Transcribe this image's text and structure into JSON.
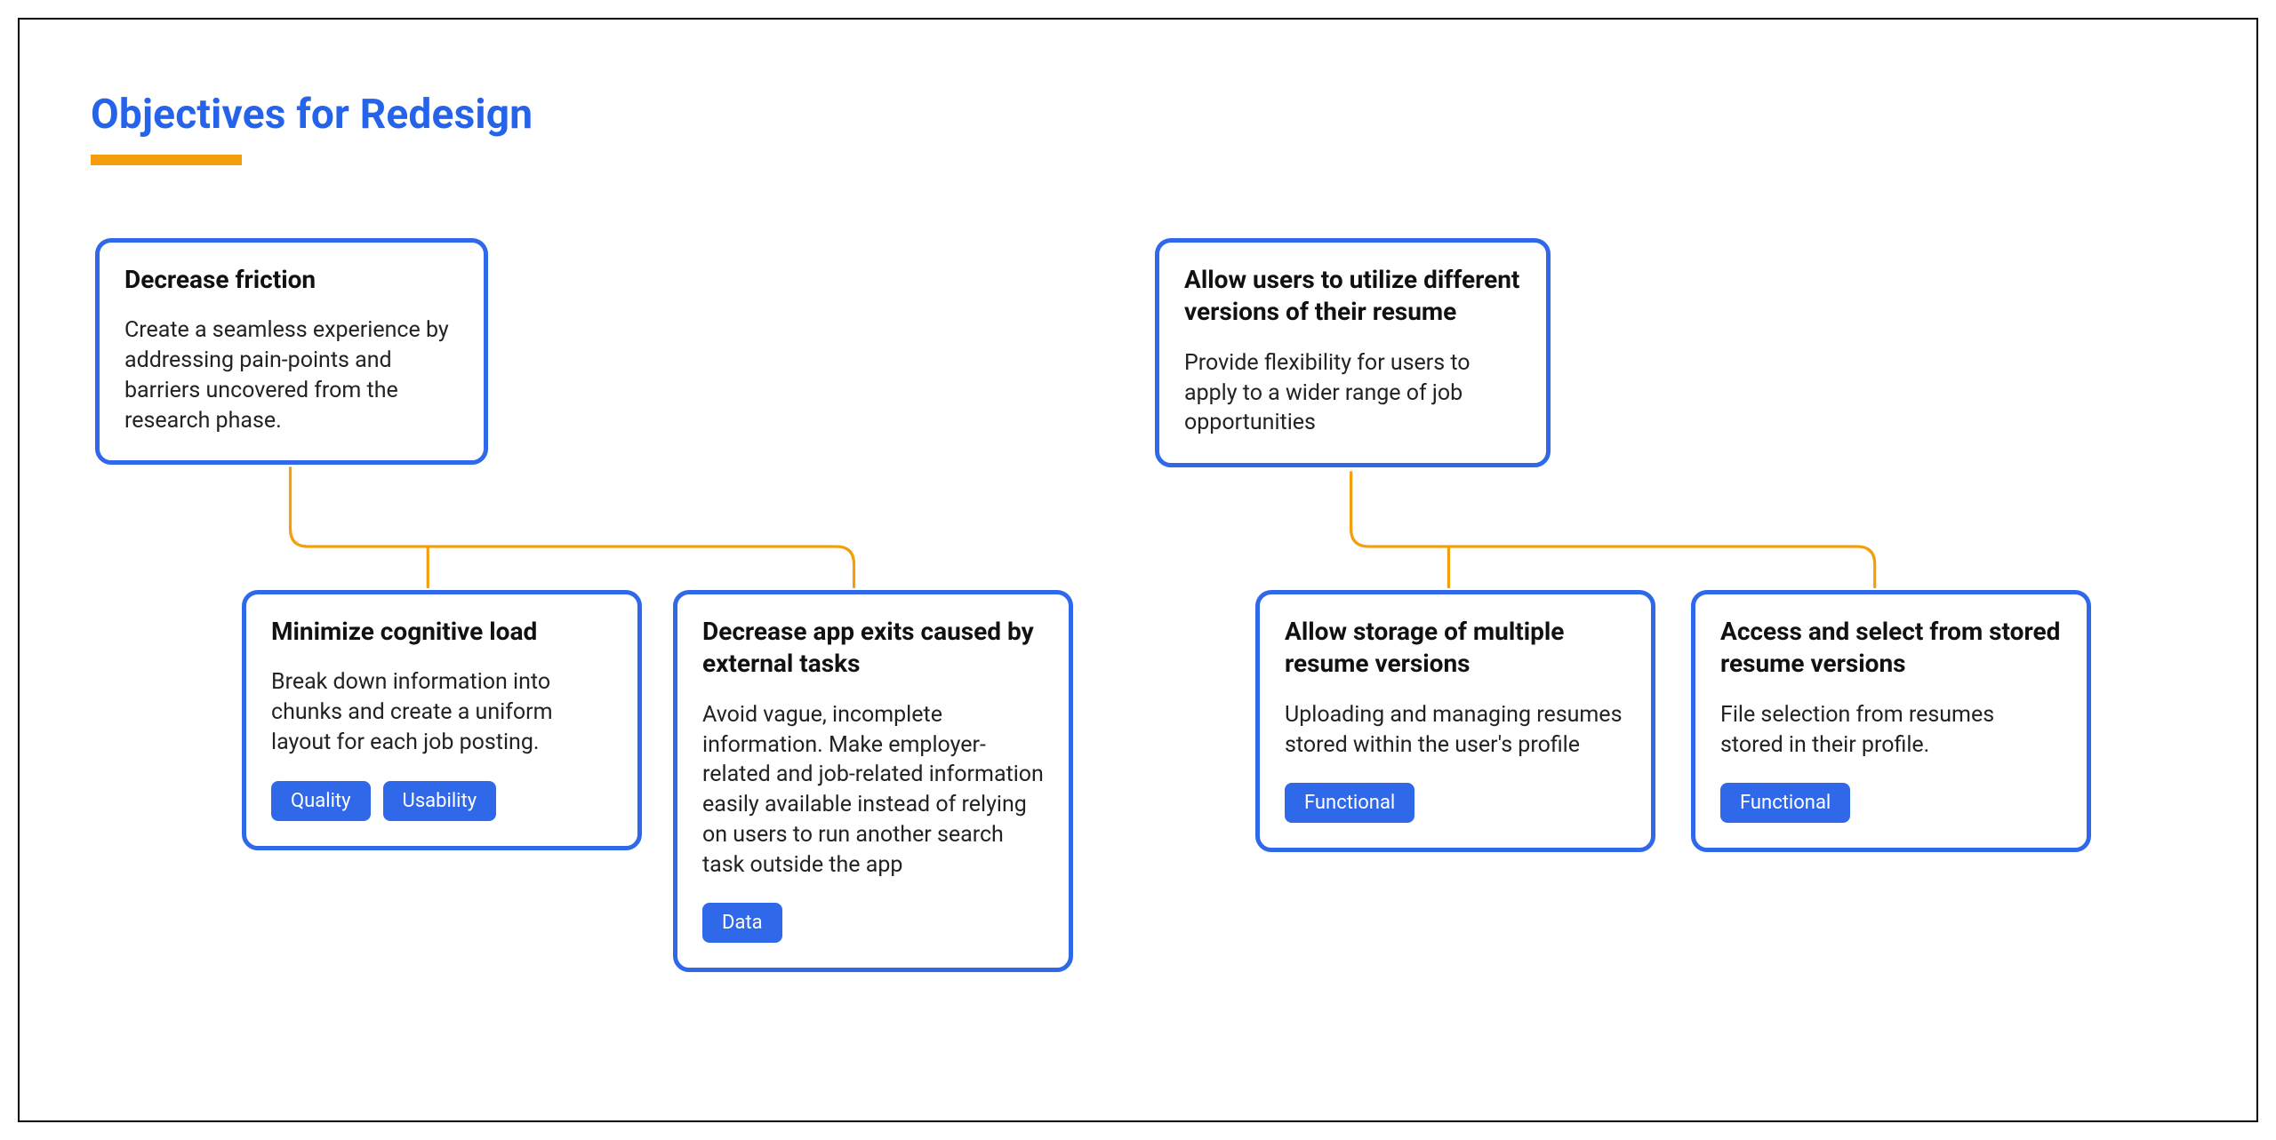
{
  "heading": "Objectives for Redesign",
  "colors": {
    "heading": "#2563eb",
    "accent": "#f59e0b",
    "box_border": "#2f68e9",
    "tag_bg": "#2f68e9"
  },
  "boxes": {
    "a": {
      "title": "Decrease friction",
      "body": "Create a seamless experience by addressing pain-points and barriers uncovered from the research phase."
    },
    "b": {
      "title": "Minimize cognitive load",
      "body": "Break down information into chunks and create a uniform layout for each job posting.",
      "tags": [
        "Quality",
        "Usability"
      ]
    },
    "c": {
      "title": "Decrease app exits caused by external tasks",
      "body": "Avoid vague, incomplete information. Make employer-related and job-related information easily available instead of relying on users to run another search task outside the app",
      "tags": [
        "Data"
      ]
    },
    "d": {
      "title": "Allow users to utilize different versions of their resume",
      "body": "Provide flexibility for users to apply to a wider range of job opportunities"
    },
    "e": {
      "title": "Allow storage of multiple resume versions",
      "body": "Uploading and managing resumes stored within the user's profile",
      "tags": [
        "Functional"
      ]
    },
    "f": {
      "title": "Access and select from stored resume versions",
      "body": "File selection from resumes stored in their profile.",
      "tags": [
        "Functional"
      ]
    }
  }
}
